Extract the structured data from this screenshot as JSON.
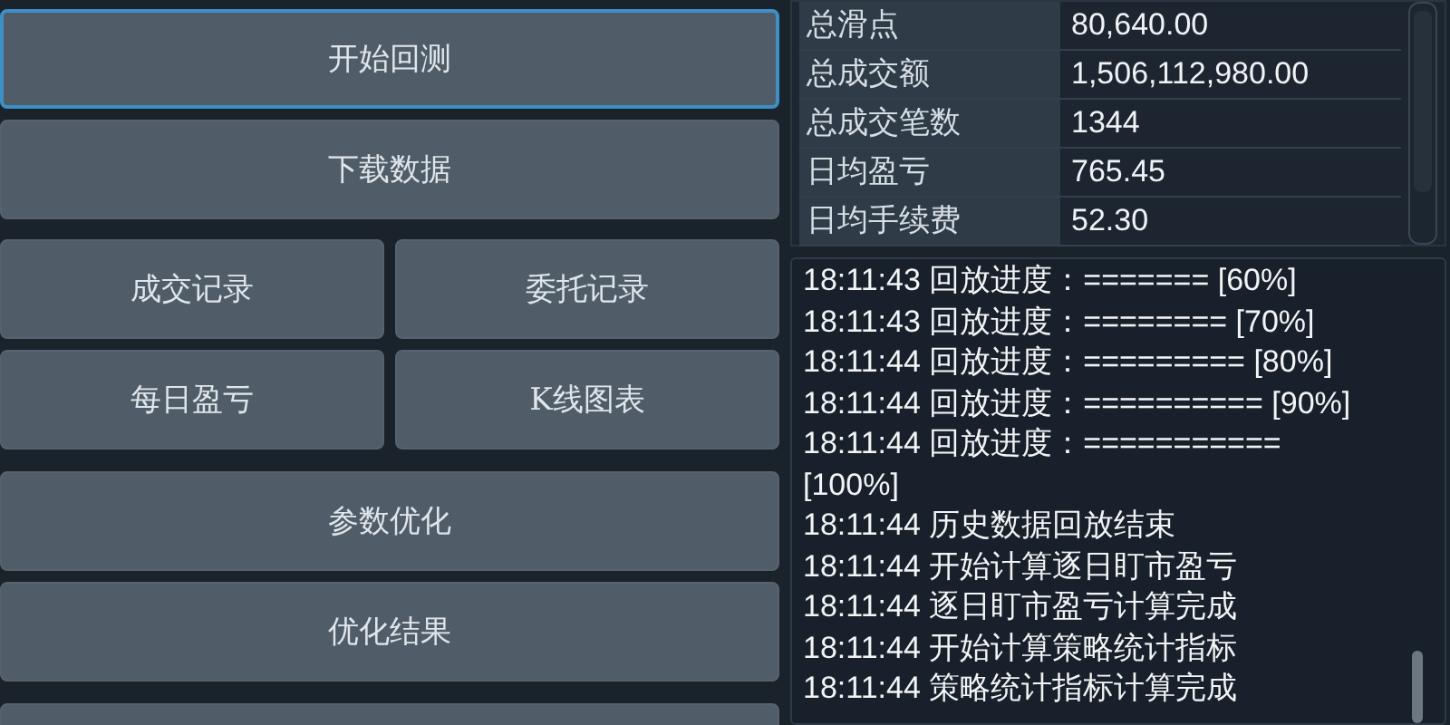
{
  "buttons": [
    {
      "label": "开始回测",
      "focused": true,
      "kind": "wide"
    },
    {
      "label": "下载数据",
      "focused": false,
      "kind": "wide"
    },
    {
      "label": "成交记录",
      "focused": false,
      "kind": "half"
    },
    {
      "label": "委托记录",
      "focused": false,
      "kind": "half"
    },
    {
      "label": "每日盈亏",
      "focused": false,
      "kind": "half"
    },
    {
      "label": "K线图表",
      "focused": false,
      "kind": "half"
    },
    {
      "label": "参数优化",
      "focused": false,
      "kind": "wide"
    },
    {
      "label": "优化结果",
      "focused": false,
      "kind": "wide"
    }
  ],
  "stats": [
    {
      "name": "总滑点",
      "value": "80,640.00"
    },
    {
      "name": "总成交额",
      "value": "1,506,112,980.00"
    },
    {
      "name": "总成交笔数",
      "value": "1344"
    },
    {
      "name": "日均盈亏",
      "value": "765.45"
    },
    {
      "name": "日均手续费",
      "value": "52.30"
    }
  ],
  "log": [
    "18:11:43 回放进度：======= [60%]",
    "18:11:43 回放进度：======== [70%]",
    "18:11:44 回放进度：========= [80%]",
    "18:11:44 回放进度：========== [90%]",
    "18:11:44 回放进度：=========== [100%]",
    "18:11:44 历史数据回放结束",
    "18:11:44 开始计算逐日盯市盈亏",
    "18:11:44 逐日盯市盈亏计算完成",
    "18:11:44 开始计算策略统计指标",
    "18:11:44 策略统计指标计算完成"
  ]
}
